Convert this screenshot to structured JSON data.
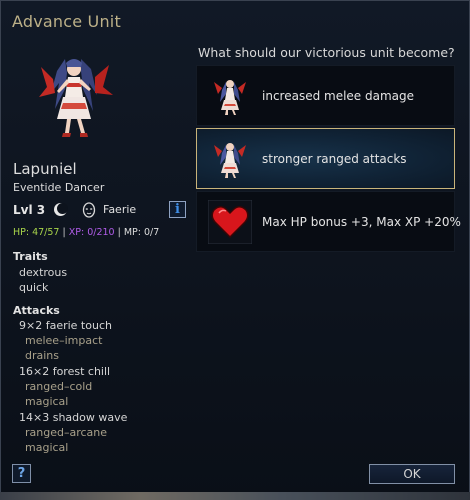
{
  "dialog": {
    "title": "Advance Unit",
    "question": "What should our victorious unit become?",
    "help_label": "?",
    "ok_label": "OK"
  },
  "unit": {
    "name": "Lapuniel",
    "type": "Eventide Dancer",
    "level": "Lvl 3",
    "alignment_icon": "moon-icon",
    "race_icon": "faerie-mask-icon",
    "race": "Faerie",
    "info_label": "i",
    "stats": {
      "hp": "HP: 47/57",
      "xp": "XP: 0/210",
      "mp": "MP: 0/7",
      "separator": "|"
    },
    "colors": {
      "hp": "#a7d34a",
      "xp": "#b05ce8"
    },
    "traits_header": "Traits",
    "traits": [
      "dextrous",
      "quick"
    ],
    "attacks_header": "Attacks",
    "attacks": [
      {
        "name": "9×2 faerie touch",
        "type": "melee–impact",
        "special": "drains"
      },
      {
        "name": "16×2 forest chill",
        "type": "ranged–cold",
        "special": "magical"
      },
      {
        "name": "14×3 shadow wave",
        "type": "ranged–arcane",
        "special": "magical"
      }
    ]
  },
  "options": [
    {
      "label": "increased melee damage",
      "icon": "faerie-unit-icon",
      "selected": false
    },
    {
      "label": "stronger ranged attacks",
      "icon": "faerie-unit-icon",
      "selected": true
    },
    {
      "label": "Max HP bonus +3, Max XP +20%",
      "icon": "heart-icon",
      "selected": false
    }
  ]
}
